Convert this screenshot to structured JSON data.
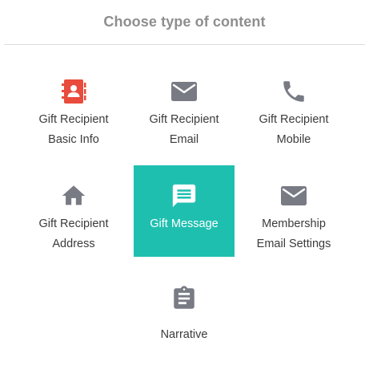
{
  "header": {
    "title": "Choose type of content"
  },
  "colors": {
    "accent": "#1fbfb0",
    "icon_gray": "#787b84",
    "contact_red": "#e94b3c",
    "text": "#3b3b3b",
    "title": "#8e8e8e"
  },
  "tiles": [
    {
      "line1": "Gift Recipient",
      "line2": "Basic Info",
      "icon": "contact-book-icon",
      "selected": false
    },
    {
      "line1": "Gift Recipient",
      "line2": "Email",
      "icon": "envelope-icon",
      "selected": false
    },
    {
      "line1": "Gift Recipient",
      "line2": "Mobile",
      "icon": "phone-icon",
      "selected": false
    },
    {
      "line1": "Gift Recipient",
      "line2": "Address",
      "icon": "home-icon",
      "selected": false
    },
    {
      "line1": "Gift Message",
      "line2": "",
      "icon": "message-icon",
      "selected": true
    },
    {
      "line1": "Membership",
      "line2": "Email Settings",
      "icon": "envelope-icon",
      "selected": false
    },
    {
      "line1": "Narrative",
      "line2": "",
      "icon": "clipboard-icon",
      "selected": false
    }
  ]
}
